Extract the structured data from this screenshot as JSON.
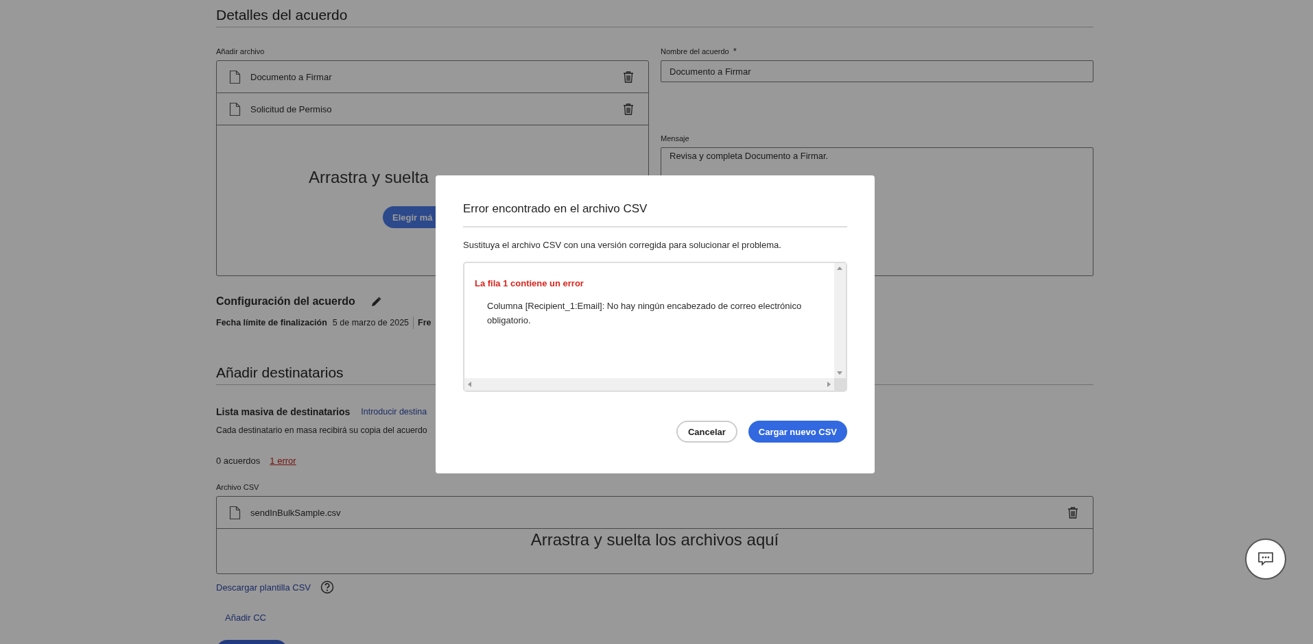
{
  "agreement_details": {
    "title": "Detalles del acuerdo",
    "add_file_label": "Añadir archivo",
    "files": [
      {
        "name": "Documento a Firmar"
      },
      {
        "name": "Solicitud de Permiso"
      }
    ],
    "drop_text": "Arrastra y suelta",
    "choose_button": "Elegir má",
    "name_label": "Nombre del acuerdo",
    "required_mark": "*",
    "name_value": "Documento a Firmar",
    "message_label": "Mensaje",
    "message_value": "Revisa y completa Documento a Firmar."
  },
  "settings": {
    "title": "Configuración del acuerdo",
    "fields": [
      {
        "label": "Fecha límite de finalización",
        "value": "5 de marzo de 2025"
      },
      {
        "label": "Fre"
      }
    ]
  },
  "recipients": {
    "title": "Añadir destinatarios",
    "bulk_title": "Lista masiva de destinatarios",
    "enter_link": "Introducir destina",
    "note": "Cada destinatario en masa recibirá su copia del acuerdo",
    "agreements_count": "0 acuerdos",
    "error_link": "1 error",
    "csv_label": "Archivo CSV",
    "csv_files": [
      {
        "name": "sendInBulkSample.csv"
      }
    ],
    "drop_text": "Arrastra y suelta los archivos aquí",
    "template_link": "Descargar plantilla CSV",
    "add_cc": "Añadir CC"
  },
  "dialog": {
    "title": "Error encontrado en el archivo CSV",
    "description": "Sustituya el archivo CSV con una versión corregida para solucionar el problema.",
    "errors": [
      {
        "title": "La fila 1 contiene un error",
        "message": "Columna [Recipient_1:Email]: No hay ningún encabezado de correo electrónico obligatorio."
      }
    ],
    "buttons": [
      {
        "label": "Cancelar",
        "kind": "secondary"
      },
      {
        "label": "Cargar nuevo CSV",
        "kind": "primary"
      }
    ]
  }
}
